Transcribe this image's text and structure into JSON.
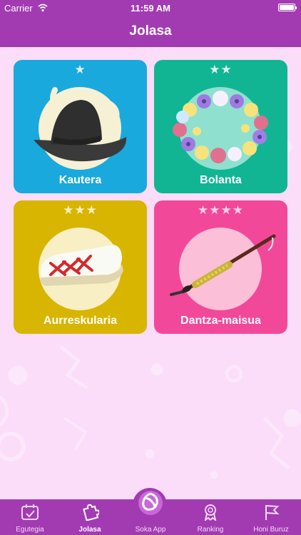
{
  "status_bar": {
    "carrier": "Carrier",
    "time": "11:59 AM"
  },
  "nav": {
    "title": "Jolasa"
  },
  "levels": [
    {
      "stars": "★",
      "label": "Kautera",
      "color": "#1aa9dc",
      "illustration": "hat-with-horns-icon"
    },
    {
      "stars": "★★",
      "label": "Bolanta",
      "color": "#11b593",
      "illustration": "flower-wreath-icon"
    },
    {
      "stars": "★★★",
      "label": "Aurreskularia",
      "color": "#d8b500",
      "illustration": "espadrille-shoe-icon"
    },
    {
      "stars": "★★★★",
      "label": "Dantza-maisua",
      "color": "#f24899",
      "illustration": "staff-stick-icon"
    }
  ],
  "tabs": [
    {
      "label": "Egutegia",
      "icon": "calendar-icon"
    },
    {
      "label": "Jolasa",
      "icon": "puzzle-icon",
      "active": true
    },
    {
      "label": "Soka App",
      "icon": "soka-logo-icon"
    },
    {
      "label": "Ranking",
      "icon": "medal-icon"
    },
    {
      "label": "Honi Buruz",
      "icon": "flag-icon"
    }
  ],
  "colors": {
    "header": "#a23bb2",
    "background": "#fbdcf9"
  }
}
